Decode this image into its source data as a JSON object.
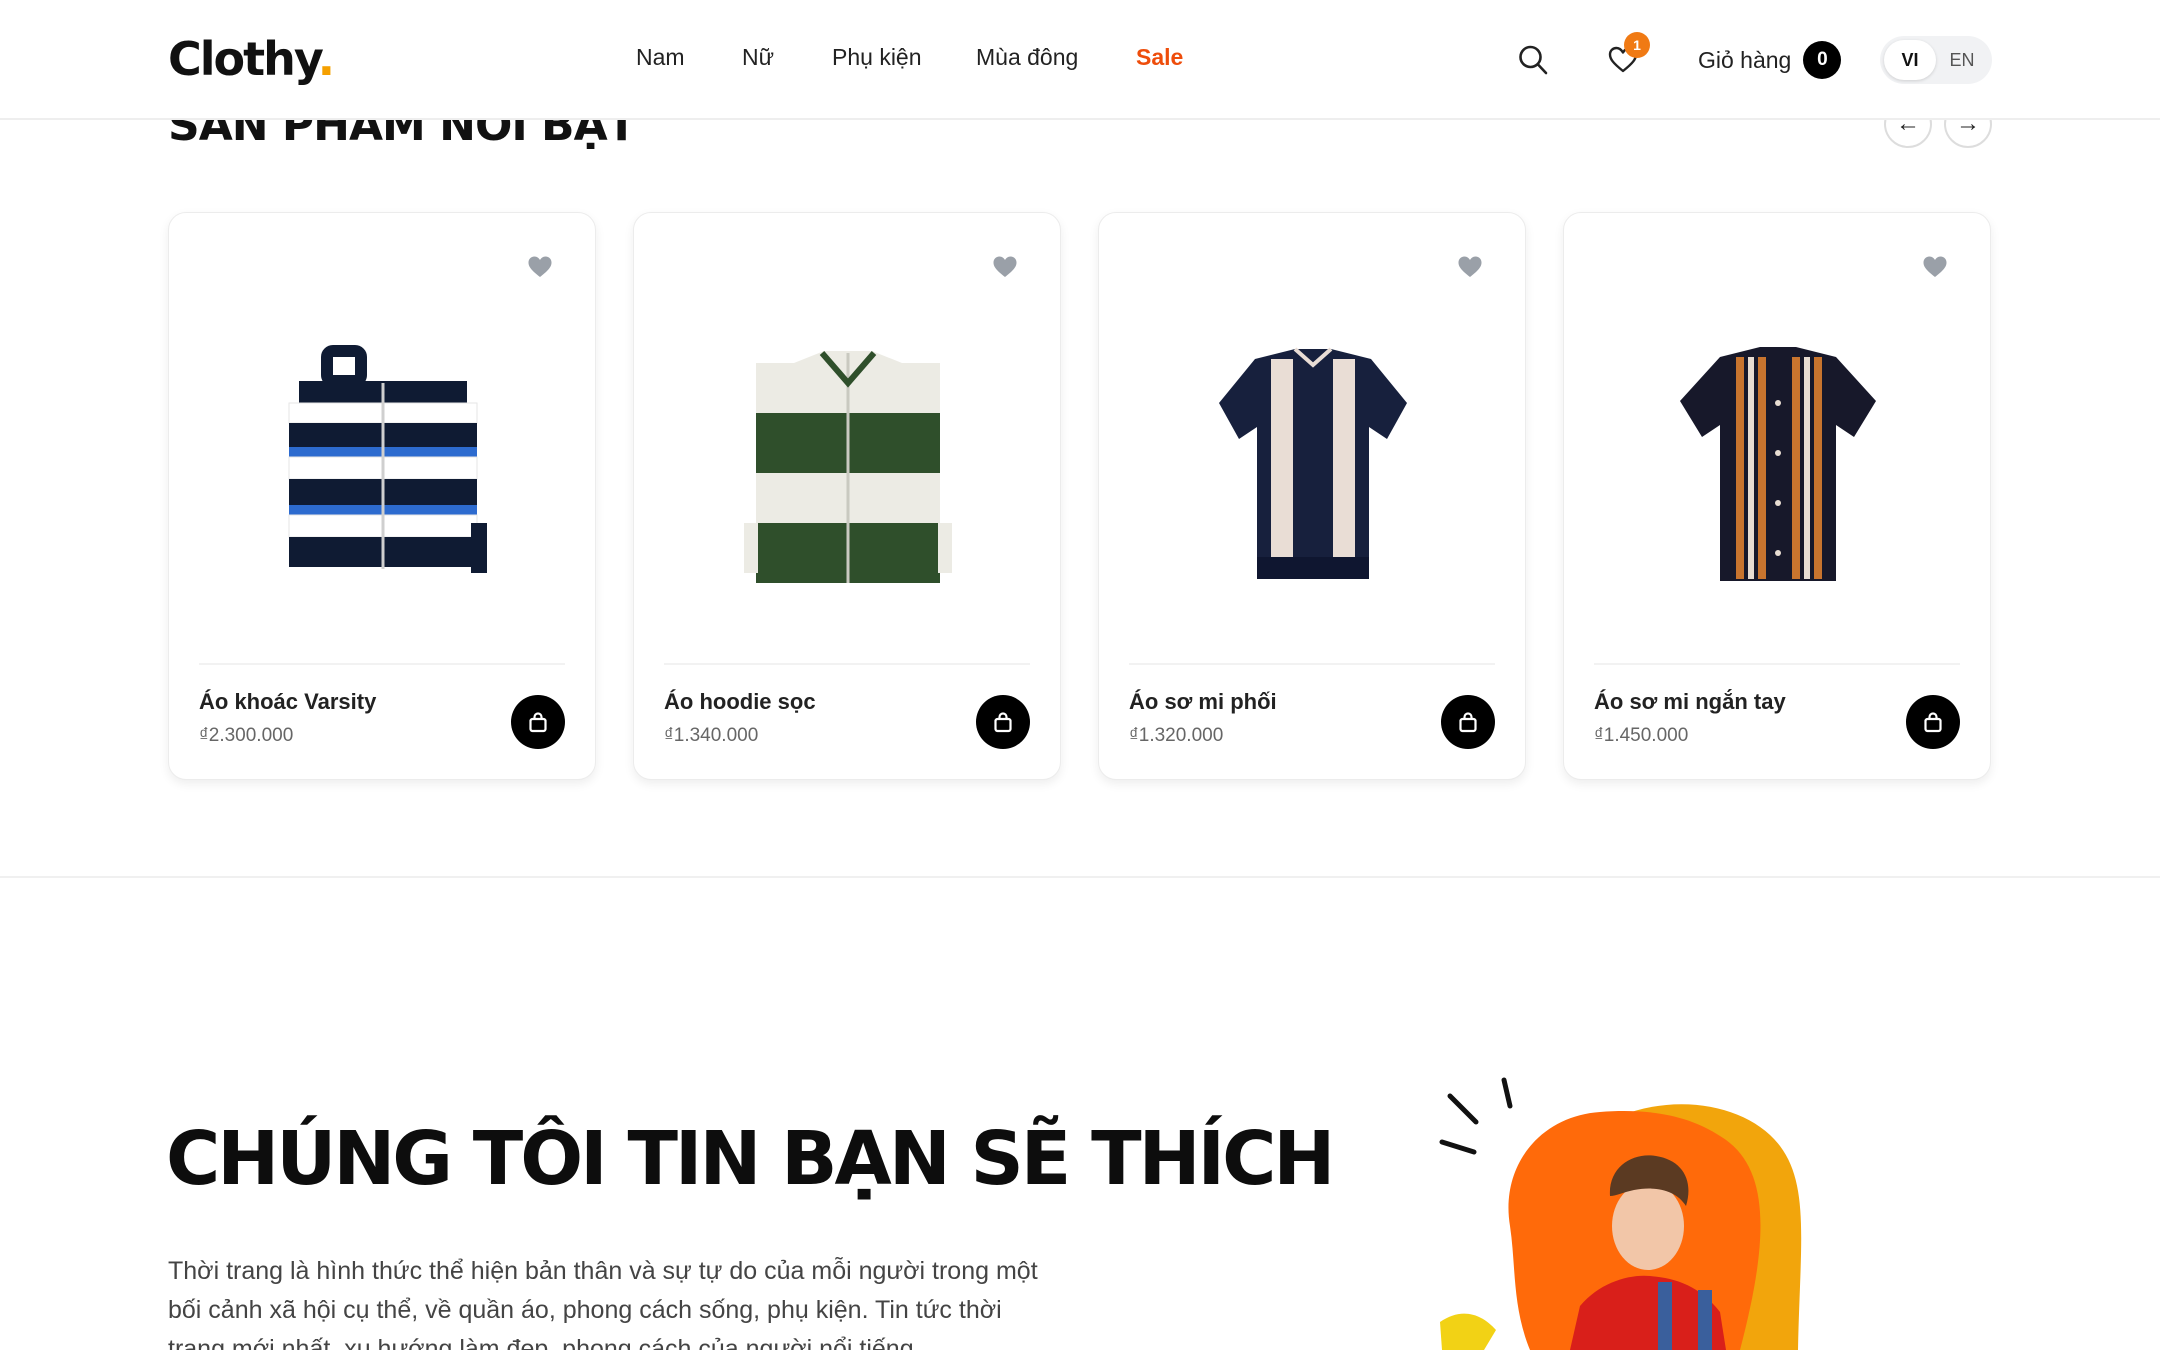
{
  "header": {
    "logo_text": "Clothy",
    "logo_dot": ".",
    "nav": [
      "Nam",
      "Nữ",
      "Phụ kiện",
      "Mùa đông",
      "Sale"
    ],
    "wishlist_count": "1",
    "cart_label": "Giỏ hàng",
    "cart_count": "0",
    "languages": [
      "VI",
      "EN"
    ],
    "active_language": "VI",
    "icons": [
      "search-icon",
      "heart-icon"
    ]
  },
  "featured": {
    "title": "SẢN PHẨM NỔI BẬT",
    "prev_arrow": "←",
    "next_arrow": "→",
    "products": [
      {
        "name": "Áo khoác Varsity",
        "price": "₫2.300.000"
      },
      {
        "name": "Áo hoodie sọc",
        "price": "₫1.340.000"
      },
      {
        "name": "Áo sơ mi phối",
        "price": "₫1.320.000"
      },
      {
        "name": "Áo sơ mi ngắn tay",
        "price": "₫1.450.000"
      }
    ]
  },
  "promo": {
    "title": "CHÚNG TÔI TIN BẠN SẼ THÍCH",
    "text": "Thời trang là hình thức thể hiện bản thân và sự tự do của mỗi người trong một bối cảnh xã hội cụ thể, về quần áo, phong cách sống, phụ kiện. Tin tức thời trang mới nhất, xu hướng làm đẹp, phong cách của người nổi tiếng"
  },
  "colors": {
    "accent": "#ee4d0b",
    "logo_dot": "#f5a000",
    "badge": "#f07a14",
    "blob_orange": "#ff6a0a",
    "blob_yellow": "#f2a50c"
  }
}
